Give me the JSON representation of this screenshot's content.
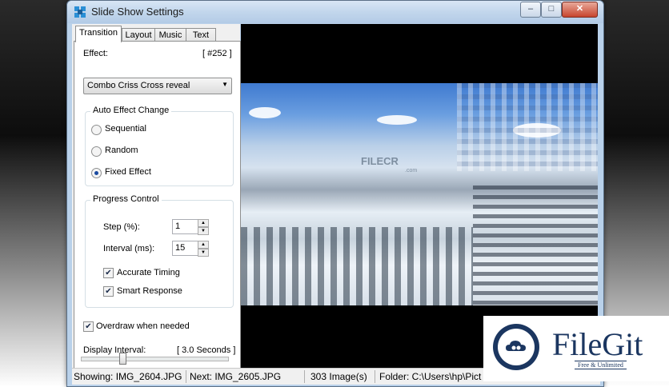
{
  "window": {
    "title": "Slide Show Settings",
    "buttons": {
      "minimize": "‒",
      "maximize": "□",
      "close": "✕"
    }
  },
  "tabs": [
    "Transition",
    "Layout",
    "Music",
    "Text"
  ],
  "transition": {
    "effect_label": "Effect:",
    "effect_number": "[ #252 ]",
    "effect_value": "Combo Criss Cross reveal",
    "auto_effect": {
      "title": "Auto Effect Change",
      "options": [
        "Sequential",
        "Random",
        "Fixed Effect"
      ],
      "selected": "Fixed Effect"
    },
    "progress": {
      "title": "Progress Control",
      "step_label": "Step (%):",
      "step_value": "1",
      "interval_label": "Interval (ms):",
      "interval_value": "15",
      "accurate_timing": "Accurate Timing",
      "smart_response": "Smart Response"
    },
    "overdraw": "Overdraw when needed",
    "display_interval_label": "Display Interval:",
    "display_interval_value": "[ 3.0 Seconds ]"
  },
  "preview": {
    "watermark": "FILECR",
    "watermark_sub": ".com"
  },
  "status": {
    "showing": "Showing: IMG_2604.JPG",
    "next": "Next: IMG_2605.JPG",
    "count": "303 Image(s)",
    "folder": "Folder: C:\\Users\\hp\\Pict"
  },
  "overlay": {
    "brand": "FileGit",
    "tagline": "Free & Unlimited"
  }
}
